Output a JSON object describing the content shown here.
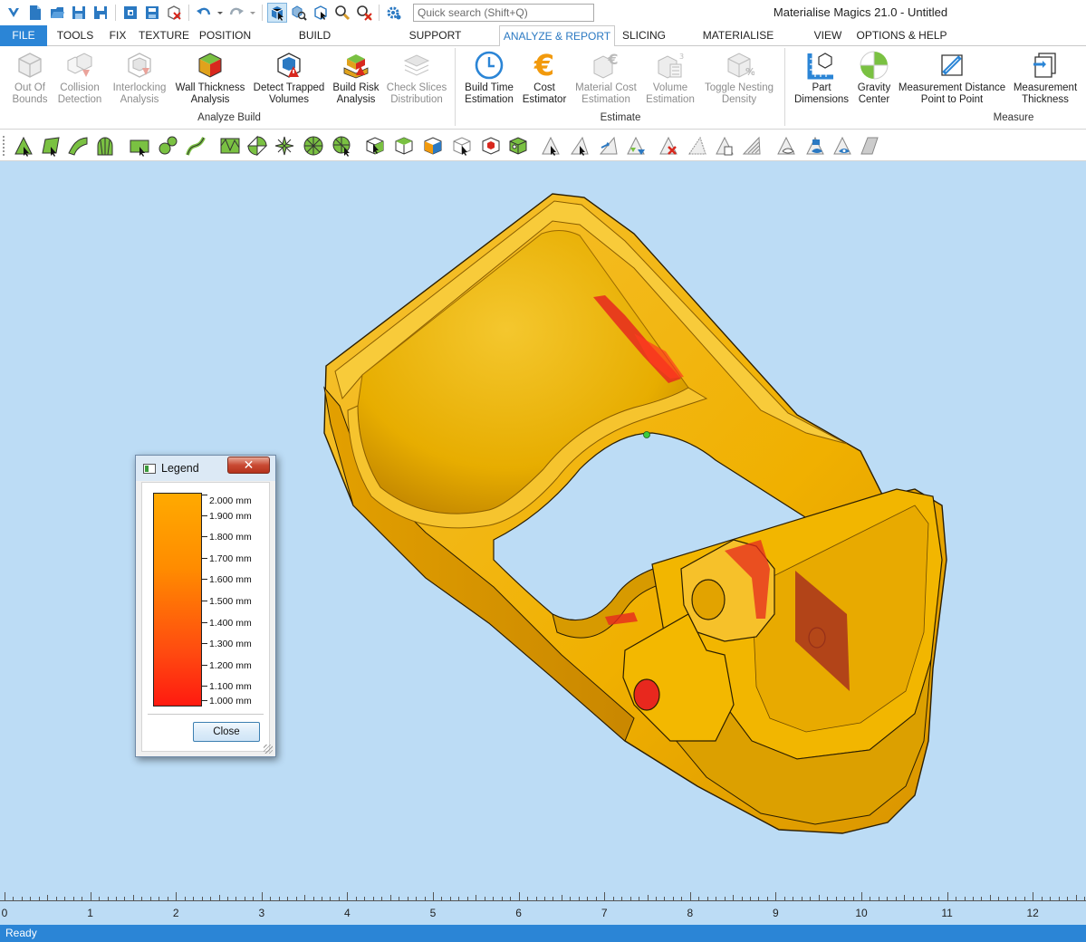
{
  "window": {
    "title": "Materialise Magics 21.0 - Untitled",
    "search_placeholder": "Quick search (Shift+Q)"
  },
  "quick_access": {
    "icons": [
      "app-logo-icon",
      "new-file-icon",
      "open-file-icon",
      "save-icon",
      "save-as-icon",
      "import-part-icon",
      "load-icon",
      "unload-part-icon",
      "undo-icon",
      "undo-dropdown-icon",
      "redo-icon",
      "redo-dropdown-icon",
      "select-mode-icon",
      "zoom-select-icon",
      "select-part-icon",
      "zoom-icon",
      "zoom-remove-icon",
      "settings-icon"
    ]
  },
  "menu": {
    "tabs": [
      "FILE",
      "TOOLS",
      "FIX",
      "TEXTURE",
      "POSITION",
      "BUILD PREPARATION",
      "SUPPORT GENERATION",
      "ANALYZE & REPORT",
      "SLICING",
      "MATERIALISE SOFTWARE",
      "VIEW",
      "OPTIONS & HELP"
    ],
    "active": "ANALYZE & REPORT"
  },
  "ribbon": {
    "analyze_build": {
      "label": "Analyze Build",
      "items": [
        {
          "label": "Out Of\nBounds",
          "disabled": true
        },
        {
          "label": "Collision\nDetection",
          "disabled": true
        },
        {
          "label": "Interlocking\nAnalysis",
          "disabled": true
        },
        {
          "label": "Wall Thickness\nAnalysis",
          "disabled": false
        },
        {
          "label": "Detect Trapped\nVolumes",
          "disabled": false
        },
        {
          "label": "Build Risk\nAnalysis",
          "disabled": false
        },
        {
          "label": "Check Slices\nDistribution",
          "disabled": true
        }
      ]
    },
    "estimate": {
      "label": "Estimate",
      "items": [
        {
          "label": "Build Time\nEstimation",
          "disabled": false
        },
        {
          "label": "Cost\nEstimator",
          "disabled": false
        },
        {
          "label": "Material Cost\nEstimation",
          "disabled": true
        },
        {
          "label": "Volume\nEstimation",
          "disabled": true
        },
        {
          "label": "Toggle Nesting\nDensity",
          "disabled": true
        }
      ]
    },
    "measure": {
      "label": "Measure",
      "items": [
        {
          "label": "Part\nDimensions",
          "disabled": false
        },
        {
          "label": "Gravity\nCenter",
          "disabled": false
        },
        {
          "label": "Measurement Distance\nPoint to Point",
          "disabled": false
        },
        {
          "label": "Measurement\nThickness",
          "disabled": false
        }
      ]
    }
  },
  "toolstrip": {
    "icons": [
      "mark-triangle-icon",
      "mark-plane-icon",
      "mark-surface-icon",
      "mark-shell-icon",
      "mark-window-icon",
      "mark-contour-icon",
      "mark-curve-icon",
      "mark-noise-icon",
      "mark-sphere-icon",
      "mark-star-icon",
      "mark-wheel-icon",
      "mark-all-icon",
      "part-view-1-icon",
      "part-view-2-icon",
      "part-view-3-icon",
      "part-view-4-icon",
      "part-view-5-icon",
      "part-view-6-icon",
      "triangle-select-icon",
      "triangle-expand-icon",
      "triangle-grow-icon",
      "triangle-shrink-icon",
      "triangle-delete-icon",
      "triangle-invert-icon",
      "triangle-copy-icon",
      "triangle-stripes-icon",
      "hide-triangle-icon",
      "show-triangle-icon",
      "visibility-icon",
      "transparency-icon"
    ]
  },
  "legend": {
    "title": "Legend",
    "close_x": "✕",
    "labels": [
      "2.000 mm",
      "1.900 mm",
      "1.800 mm",
      "1.700 mm",
      "1.600 mm",
      "1.500 mm",
      "1.400 mm",
      "1.300 mm",
      "1.200 mm",
      "1.100 mm",
      "1.000 mm"
    ],
    "button": "Close",
    "colors": {
      "top": "#ffaa00",
      "bottom": "#ff1a10"
    }
  },
  "ruler": {
    "numbers": [
      "0",
      "1",
      "2",
      "3",
      "4",
      "5",
      "6",
      "7",
      "8",
      "9",
      "10",
      "11",
      "12"
    ]
  },
  "status": {
    "text": "Ready"
  },
  "colors": {
    "accent": "#2b85d6",
    "viewport": "#bcdcf5",
    "part": "#f0b400",
    "thin_wall": "#e6281e"
  }
}
